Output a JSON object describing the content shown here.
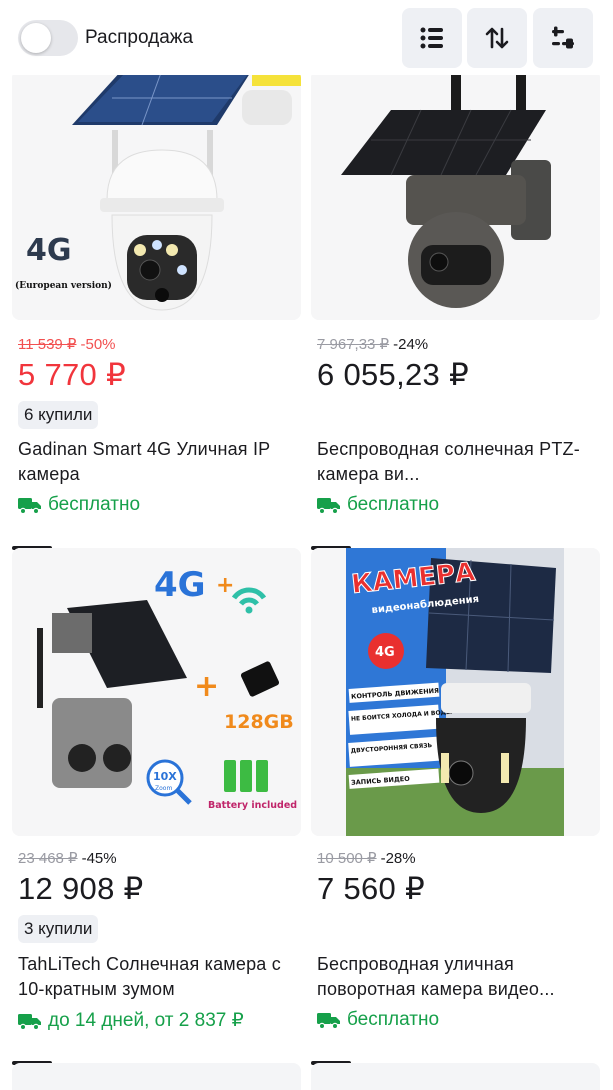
{
  "filters": {
    "sale_label": "Распродажа",
    "sale_enabled": false
  },
  "toolbar": {
    "icons": [
      "list-view-icon",
      "sort-icon",
      "filter-icon"
    ]
  },
  "products": [
    {
      "old_price": "11 539 ₽",
      "discount": "-50%",
      "price": "5 770 ₽",
      "bought": "6 купили",
      "title": "Gadinan Smart 4G Уличная IP камера",
      "delivery": "бесплатно",
      "image_text": "4G",
      "image_subtext": "(European version)"
    },
    {
      "old_price": "7 967,33 ₽",
      "discount": "-24%",
      "price": "6 055,23 ₽",
      "title": "Беспроводная солнечная PTZ-камера ви...",
      "delivery": "бесплатно"
    },
    {
      "old_price": "23 468 ₽",
      "discount": "-45%",
      "price": "12 908 ₽",
      "bought": "3 купили",
      "title": "TahLiTech Солнечная камера с 10-кратным зумом",
      "delivery": "до 14 дней, от 2 837 ₽",
      "image_text": "4G",
      "image_storage": "128GB",
      "image_zoom": "10X",
      "image_zoom_sub": "Zoom",
      "image_battery": "Battery included"
    },
    {
      "old_price": "10 500 ₽",
      "discount": "-28%",
      "price": "7 560 ₽",
      "title": "Беспроводная уличная поворотная камера видео...",
      "delivery": "бесплатно",
      "image_title": "КАМЕРА",
      "image_subtitle": "видеонаблюдения",
      "image_badge": "4G",
      "image_features": [
        "КОНТРОЛЬ ДВИЖЕНИЯ",
        "НЕ БОИТСЯ ХОЛОДА И ВОДЫ",
        "ДВУСТОРОННЯЯ СВЯЗЬ",
        "ЗАПИСЬ ВИДЕО"
      ]
    }
  ],
  "colors": {
    "sale_price": "#f1353c",
    "delivery_green": "#16a04a",
    "muted": "#9a9ba3",
    "chip_bg": "#eef0f4"
  }
}
